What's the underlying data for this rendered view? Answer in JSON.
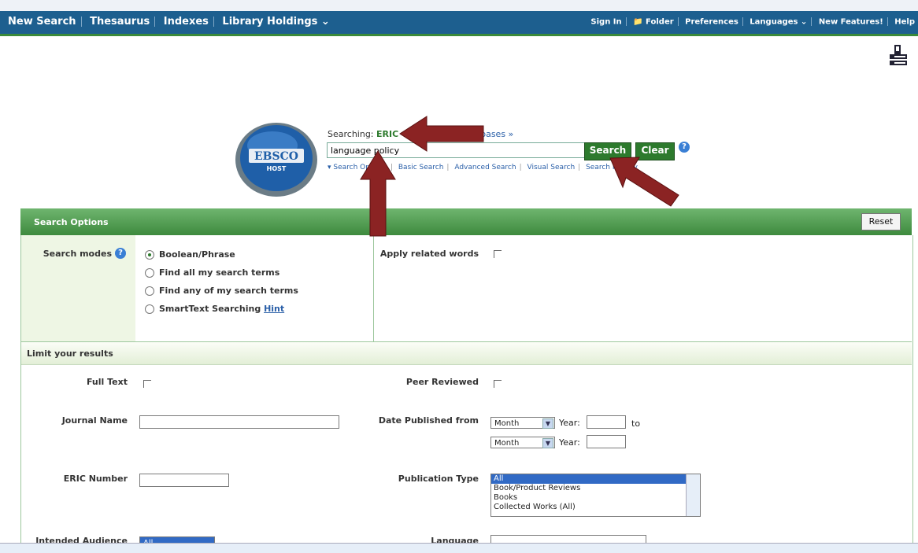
{
  "topbar": {
    "left": [
      "New Search",
      "Thesaurus",
      "Indexes",
      "Library Holdings ⌄"
    ],
    "right": [
      "Sign In",
      "📁 Folder",
      "Preferences",
      "Languages ⌄",
      "New Features!",
      "Help"
    ]
  },
  "header": {
    "searching_label": "Searching:",
    "database": "ERIC",
    "choose_databases": "Choose Databases »",
    "search_value": "language policy",
    "search_button": "Search",
    "clear_button": "Clear",
    "links": [
      "▾ Search Options",
      "Basic Search",
      "Advanced Search",
      "Visual Search",
      "Search History"
    ]
  },
  "search_options": {
    "title": "Search Options",
    "reset_label": "Reset",
    "modes_label": "Search modes",
    "modes": [
      "Boolean/Phrase",
      "Find all my search terms",
      "Find any of my search terms",
      "SmartText Searching"
    ],
    "hint": "Hint",
    "related_label": "Apply related words"
  },
  "limits": {
    "title": "Limit your results",
    "full_text": "Full Text",
    "peer_reviewed": "Peer Reviewed",
    "journal_name": "Journal Name",
    "date_from": "Date Published from",
    "month": "Month",
    "year": "Year:",
    "to": "to",
    "eric_number": "ERIC Number",
    "pub_type": "Publication Type",
    "pub_types": [
      "All",
      "Book/Product Reviews",
      "Books",
      "Collected Works (All)"
    ],
    "intended_audience": "Intended Audience",
    "audience_selected": "All",
    "language": "Language"
  },
  "colors": {
    "topbar": "#1d5f8f",
    "green": "#2d7a2d",
    "arrow": "#8b2323"
  }
}
